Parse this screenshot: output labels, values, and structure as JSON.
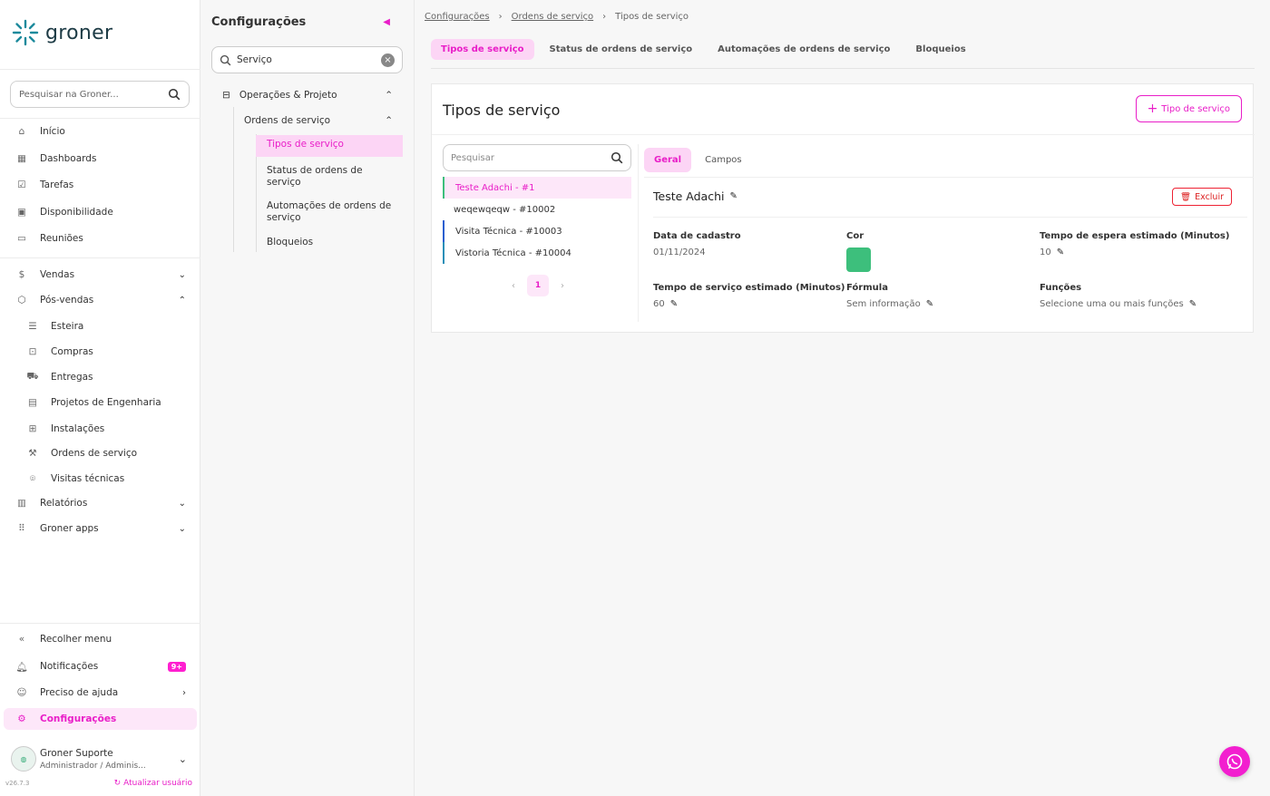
{
  "brand": {
    "name": "groner",
    "accent": "#e91ec8"
  },
  "sidebar": {
    "search_placeholder": "Pesquisar na Groner...",
    "items": [
      {
        "label": "Início",
        "icon": "home-icon"
      },
      {
        "label": "Dashboards",
        "icon": "dashboard-icon"
      },
      {
        "label": "Tarefas",
        "icon": "checkbox-icon"
      },
      {
        "label": "Disponibilidade",
        "icon": "calendar-clock-icon"
      },
      {
        "label": "Reuniões",
        "icon": "video-icon"
      },
      {
        "label": "Vendas",
        "icon": "dollar-icon"
      },
      {
        "label": "Pós-vendas",
        "icon": "box-icon"
      },
      {
        "label": "Esteira",
        "icon": "list-icon"
      },
      {
        "label": "Compras",
        "icon": "bag-icon"
      },
      {
        "label": "Entregas",
        "icon": "truck-icon"
      },
      {
        "label": "Projetos de Engenharia",
        "icon": "document-icon"
      },
      {
        "label": "Instalações",
        "icon": "solar-panel-icon"
      },
      {
        "label": "Ordens de serviço",
        "icon": "wrench-icon"
      },
      {
        "label": "Visitas técnicas",
        "icon": "location-icon"
      },
      {
        "label": "Relatórios",
        "icon": "bar-chart-icon"
      },
      {
        "label": "Groner apps",
        "icon": "grid-icon"
      }
    ],
    "bottom": {
      "collapse": "Recolher menu",
      "notifications": "Notificações",
      "notifications_badge": "9+",
      "help": "Preciso de ajuda",
      "settings": "Configurações"
    },
    "user": {
      "name": "Groner Suporte",
      "role": "Administrador / Adminis..."
    },
    "version": "v26.7.3",
    "update_label": "Atualizar usuário"
  },
  "config": {
    "title": "Configurações",
    "search_value": "Serviço",
    "group": "Operações & Projeto",
    "subgroup": "Ordens de serviço",
    "items": [
      "Tipos de serviço",
      "Status de ordens de serviço",
      "Automações de ordens de serviço",
      "Bloqueios"
    ]
  },
  "breadcrumb": [
    "Configurações",
    "Ordens de serviço",
    "Tipos de serviço"
  ],
  "tabs": [
    "Tipos de serviço",
    "Status de ordens de serviço",
    "Automações de ordens de serviço",
    "Bloqueios"
  ],
  "card": {
    "title": "Tipos de serviço",
    "add_button": "Tipo de serviço",
    "list_search_placeholder": "Pesquisar",
    "list": [
      "Teste Adachi - #1",
      "weqewqeqw - #10002",
      "Visita Técnica - #10003",
      "Vistoria Técnica - #10004"
    ],
    "page": "1",
    "detail_tabs": [
      "Geral",
      "Campos"
    ],
    "detail_title": "Teste Adachi",
    "delete_button": "Excluir",
    "fields": {
      "created_label": "Data de cadastro",
      "created_value": "01/11/2024",
      "color_label": "Cor",
      "color_value": "#3dbf7c",
      "wait_label": "Tempo de espera estimado (Minutos)",
      "wait_value": "10",
      "service_label": "Tempo de serviço estimado (Minutos)",
      "service_value": "60",
      "formula_label": "Fórmula",
      "formula_value": "Sem informação",
      "functions_label": "Funções",
      "functions_value": "Selecione uma ou mais funções"
    }
  }
}
